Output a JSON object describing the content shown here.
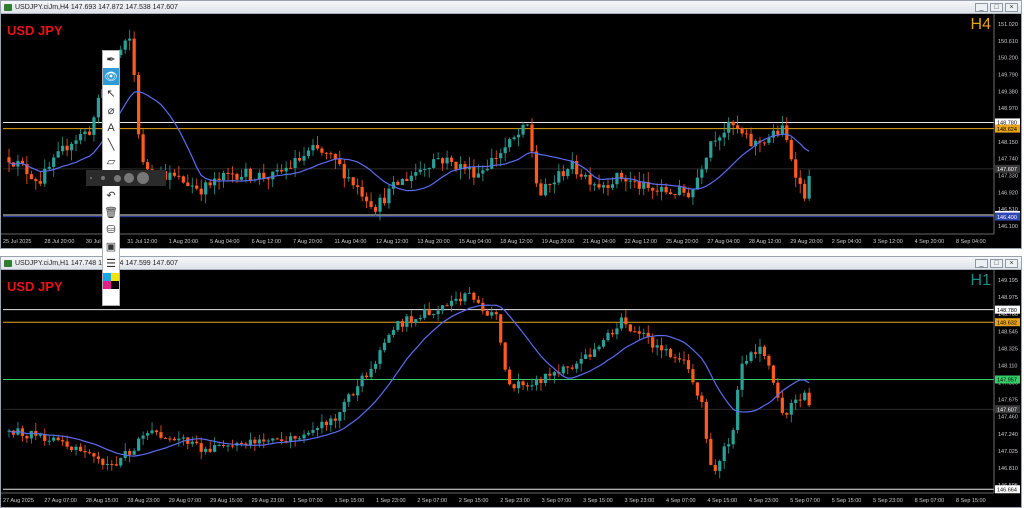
{
  "colors": {
    "bull": "#2aa198",
    "bear": "#ff5a1f",
    "ma": "#5b6cf0",
    "symbol": "#e8141a",
    "tf_top": "#e8a317",
    "tf_bottom": "#1f8a8a",
    "orange_level": "#e8a317",
    "white_level": "#e6e6e6",
    "blue_level": "#2f45b5",
    "green_level": "#33cc66"
  },
  "top_chart": {
    "title": "USDJPY.ciJm,H4  147.693 147.872 147.538 147.607",
    "symbol": "USD JPY",
    "timeframe": "H4",
    "price_min": 145.96,
    "price_max": 151.42,
    "y_labels": [
      "151.020",
      "150.610",
      "150.200",
      "149.790",
      "149.380",
      "148.970",
      "148.560",
      "148.150",
      "147.740",
      "147.330",
      "146.920",
      "146.510",
      "146.100"
    ],
    "level_labels": [
      {
        "text": "148.780",
        "price": 148.78,
        "bg": "#ffffff",
        "fg": "#000000"
      },
      {
        "text": "148.624",
        "price": 148.624,
        "bg": "#e8a317",
        "fg": "#000000"
      },
      {
        "text": "147.607",
        "price": 147.607,
        "bg": "#3a3a3a",
        "fg": "#ffffff"
      },
      {
        "text": "146.440",
        "price": 146.44,
        "bg": "#ffffff",
        "fg": "#000000"
      },
      {
        "text": "146.400",
        "price": 146.4,
        "bg": "#2f45b5",
        "fg": "#ffffff"
      }
    ],
    "x_labels": [
      "25 Jul 2025",
      "28 Jul 20:00",
      "30 Jul 04:00",
      "31 Jul 12:00",
      "1 Aug 20:00",
      "5 Aug 04:00",
      "6 Aug 12:00",
      "7 Aug 20:00",
      "11 Aug 04:00",
      "12 Aug 12:00",
      "13 Aug 20:00",
      "15 Aug 04:00",
      "18 Aug 12:00",
      "19 Aug 20:00",
      "21 Aug 04:00",
      "22 Aug 12:00",
      "25 Aug 20:00",
      "27 Aug 04:00",
      "28 Aug 12:00",
      "29 Aug 20:00",
      "2 Sep 04:00",
      "3 Sep 12:00",
      "4 Sep 20:00",
      "8 Sep 04:00"
    ]
  },
  "bottom_chart": {
    "title": "USDJPY.ciJm,H1  147.748 147.764 147.599 147.607",
    "symbol": "USD JPY",
    "timeframe": "H1",
    "price_min": 146.62,
    "price_max": 149.2,
    "y_labels": [
      "149.195",
      "148.975",
      "148.760",
      "148.545",
      "148.325",
      "148.110",
      "147.890",
      "147.675",
      "147.460",
      "147.240",
      "147.025",
      "146.810",
      "146.595"
    ],
    "level_labels": [
      {
        "text": "148.780",
        "price": 148.78,
        "bg": "#ffffff",
        "fg": "#000000"
      },
      {
        "text": "148.632",
        "price": 148.632,
        "bg": "#e8a317",
        "fg": "#000000"
      },
      {
        "text": "147.957",
        "price": 147.957,
        "bg": "#33cc66",
        "fg": "#000000"
      },
      {
        "text": "147.607",
        "price": 147.607,
        "bg": "#3a3a3a",
        "fg": "#ffffff"
      },
      {
        "text": "146.664",
        "price": 146.664,
        "bg": "#ffffff",
        "fg": "#000000"
      }
    ],
    "x_labels": [
      "27 Aug 2025",
      "27 Aug 07:00",
      "28 Aug 15:00",
      "28 Aug 23:00",
      "29 Aug 07:00",
      "29 Aug 15:00",
      "29 Aug 23:00",
      "1 Sep 07:00",
      "1 Sep 15:00",
      "1 Sep 23:00",
      "2 Sep 07:00",
      "2 Sep 15:00",
      "2 Sep 23:00",
      "3 Sep 07:00",
      "3 Sep 15:00",
      "3 Sep 23:00",
      "4 Sep 07:00",
      "4 Sep 15:00",
      "4 Sep 23:00",
      "5 Sep 07:00",
      "5 Sep 15:00",
      "5 Sep 23:00",
      "8 Sep 07:00",
      "8 Sep 15:00"
    ]
  },
  "toolbar": {
    "tools": [
      "pen-icon",
      "eye-icon",
      "cursor-icon",
      "eraser-icon",
      "text-icon",
      "line-icon",
      "highlighter-icon",
      "point-icon",
      "undo-icon",
      "delete-icon",
      "bucket-icon",
      "screenshot-icon",
      "notes-icon"
    ],
    "swatches": [
      "#1aa6e0",
      "#f4e20c",
      "#e0208c",
      "#000000"
    ]
  }
}
